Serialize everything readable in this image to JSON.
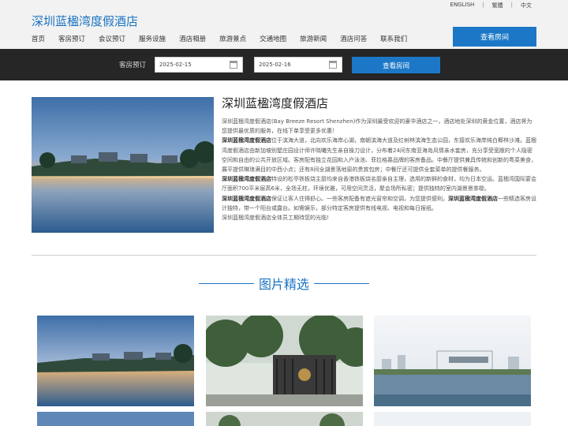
{
  "lang": {
    "en": "ENGLISH",
    "tc": "繁體",
    "sc": "中文"
  },
  "site_title": "深圳蓝楹湾度假酒店",
  "nav": [
    "首页",
    "客房预订",
    "会议预订",
    "服务设施",
    "酒店相册",
    "旅游景点",
    "交通地图",
    "旅游新闻",
    "酒店问答",
    "联系我们"
  ],
  "top_button": "查看房间",
  "booking": {
    "label": "客房预订",
    "checkin": "2025-02-15",
    "checkout": "2025-02-16",
    "search_label": "查看房间"
  },
  "intro": {
    "title": "深圳蓝楹湾度假酒店",
    "p1": "深圳蓝楹湾度假酒店(Bay Breeze Resort Shenzhen)作为深圳最受欢迎的豪华酒店之一，酒店地处深圳的黄金位置，酒店将为您提供最优质的服务，在线下单享受更多优惠！",
    "p2_b": "深圳蓝楹湾度假酒店",
    "p2": "位于滨海大道，北向欢乐海岸心湖，南朝滨海大道及红树林滨海生态公园，东接欢乐海岸纯白椰林沙滩。蓝楹湾度假酒店由新加坡别墅庄园设计师许晓曦先生亲自操刀设计，分布着24间东南亚海岛风情亲水套房，充分享受宽敞的个人隐密空间和自由的公共开放区域。客房配有独立花园和入户泳池、菲拉格慕品牌的客房备品。中餐厅提供兼具传统和创新的粤菜美食，展平提供琳琅满目的中西小点；还有8间全湖景落地窗的贵宾包房；中餐厅还可提供全套菜单的提供餐服务。",
    "p3_b": "深圳蓝楹湾度假酒店",
    "p3": "特设的松亭铁板烧主厨均来自香港铁板烧名厨亲自主理，选用的新鲜的食材，均为日本空运。蓝楹湾国际宴会厅面积700平米层高6米，全场无柱，环境优雅，可用空间灵活，聚会场所私密；提供独特的室内湖景景茶歇。",
    "p4_b": "深圳蓝楹湾度假酒店",
    "p4": "保证让客人住得舒心。一些客房配备有遮光窗帘和空调，为您提供便利。",
    "p4_b2": "深圳蓝楹湾度假酒店",
    "p4_2": "一些精选客房设计独特，带一个阳台或露台。如需娱乐，部分特定客房提供有线电视、电视和每日报纸。",
    "p5": "深圳蓝楹湾度假酒店全体员工期待您的光临!"
  },
  "gallery": {
    "title": "图片精选",
    "images": [
      {
        "icon": "lake-villas-photo"
      },
      {
        "icon": "hotel-entrance-photo"
      },
      {
        "icon": "lakeside-building-photo"
      },
      {
        "icon": "lake-villas-photo"
      },
      {
        "icon": "hotel-entrance-photo"
      },
      {
        "icon": "lakeside-building-photo"
      }
    ]
  },
  "colors": {
    "accent": "#1c78c7",
    "title_blue": "#1a73c2",
    "bar": "#262626"
  }
}
